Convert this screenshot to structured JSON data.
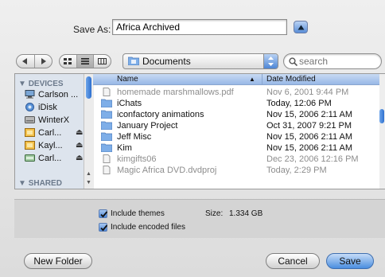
{
  "save_as": {
    "label": "Save As:",
    "value": "Africa Archived"
  },
  "toolbar": {
    "back_icon": "back-arrow-icon",
    "forward_icon": "forward-arrow-icon",
    "view_modes": [
      "icon-view-icon",
      "list-view-icon",
      "column-view-icon"
    ],
    "active_view": "list",
    "location": "Documents",
    "search_placeholder": "search"
  },
  "sidebar": {
    "devices_heading": "DEVICES",
    "shared_heading": "SHARED",
    "items": [
      {
        "label": "Carlson ...",
        "icon": "computer-icon",
        "eject": false
      },
      {
        "label": "iDisk",
        "icon": "idisk-icon",
        "eject": false
      },
      {
        "label": "WinterX",
        "icon": "hard-drive-icon",
        "eject": false
      },
      {
        "label": "Carl...",
        "icon": "disk-image-icon",
        "eject": true
      },
      {
        "label": "Kayl...",
        "icon": "disk-image-icon",
        "eject": true
      },
      {
        "label": "Carl...",
        "icon": "external-drive-icon",
        "eject": true
      }
    ],
    "eject_glyph": "⏏"
  },
  "file_list": {
    "columns": {
      "name": "Name",
      "date": "Date Modified"
    },
    "rows": [
      {
        "name": "homemade marshmallows.pdf",
        "date": "Nov 6, 2001 9:44 PM",
        "icon": "document-icon",
        "dim": true
      },
      {
        "name": "iChats",
        "date": "Today, 12:06 PM",
        "icon": "folder-icon",
        "dim": false
      },
      {
        "name": "iconfactory animations",
        "date": "Nov 15, 2006 2:11 AM",
        "icon": "folder-icon",
        "dim": false
      },
      {
        "name": "January Project",
        "date": "Oct 31, 2007 9:21 PM",
        "icon": "folder-icon",
        "dim": false
      },
      {
        "name": "Jeff Misc",
        "date": "Nov 15, 2006 2:11 AM",
        "icon": "folder-icon",
        "dim": false
      },
      {
        "name": "Kim",
        "date": "Nov 15, 2006 2:11 AM",
        "icon": "folder-icon",
        "dim": false
      },
      {
        "name": "kimgifts06",
        "date": "Dec 23, 2006 12:16 PM",
        "icon": "document-icon",
        "dim": true
      },
      {
        "name": "Magic Africa DVD.dvdproj",
        "date": "Today, 2:29 PM",
        "icon": "document-icon",
        "dim": true
      }
    ]
  },
  "options": {
    "include_themes": {
      "label": "Include themes",
      "checked": true
    },
    "include_encoded": {
      "label": "Include encoded files",
      "checked": true
    },
    "size_label": "Size:",
    "size_value": "1.334 GB"
  },
  "buttons": {
    "new_folder": "New Folder",
    "cancel": "Cancel",
    "save": "Save"
  },
  "colors": {
    "accent": "#4a8ee0",
    "folder": "#6aa2e8",
    "sidebar_bg": "#dde4ed"
  }
}
